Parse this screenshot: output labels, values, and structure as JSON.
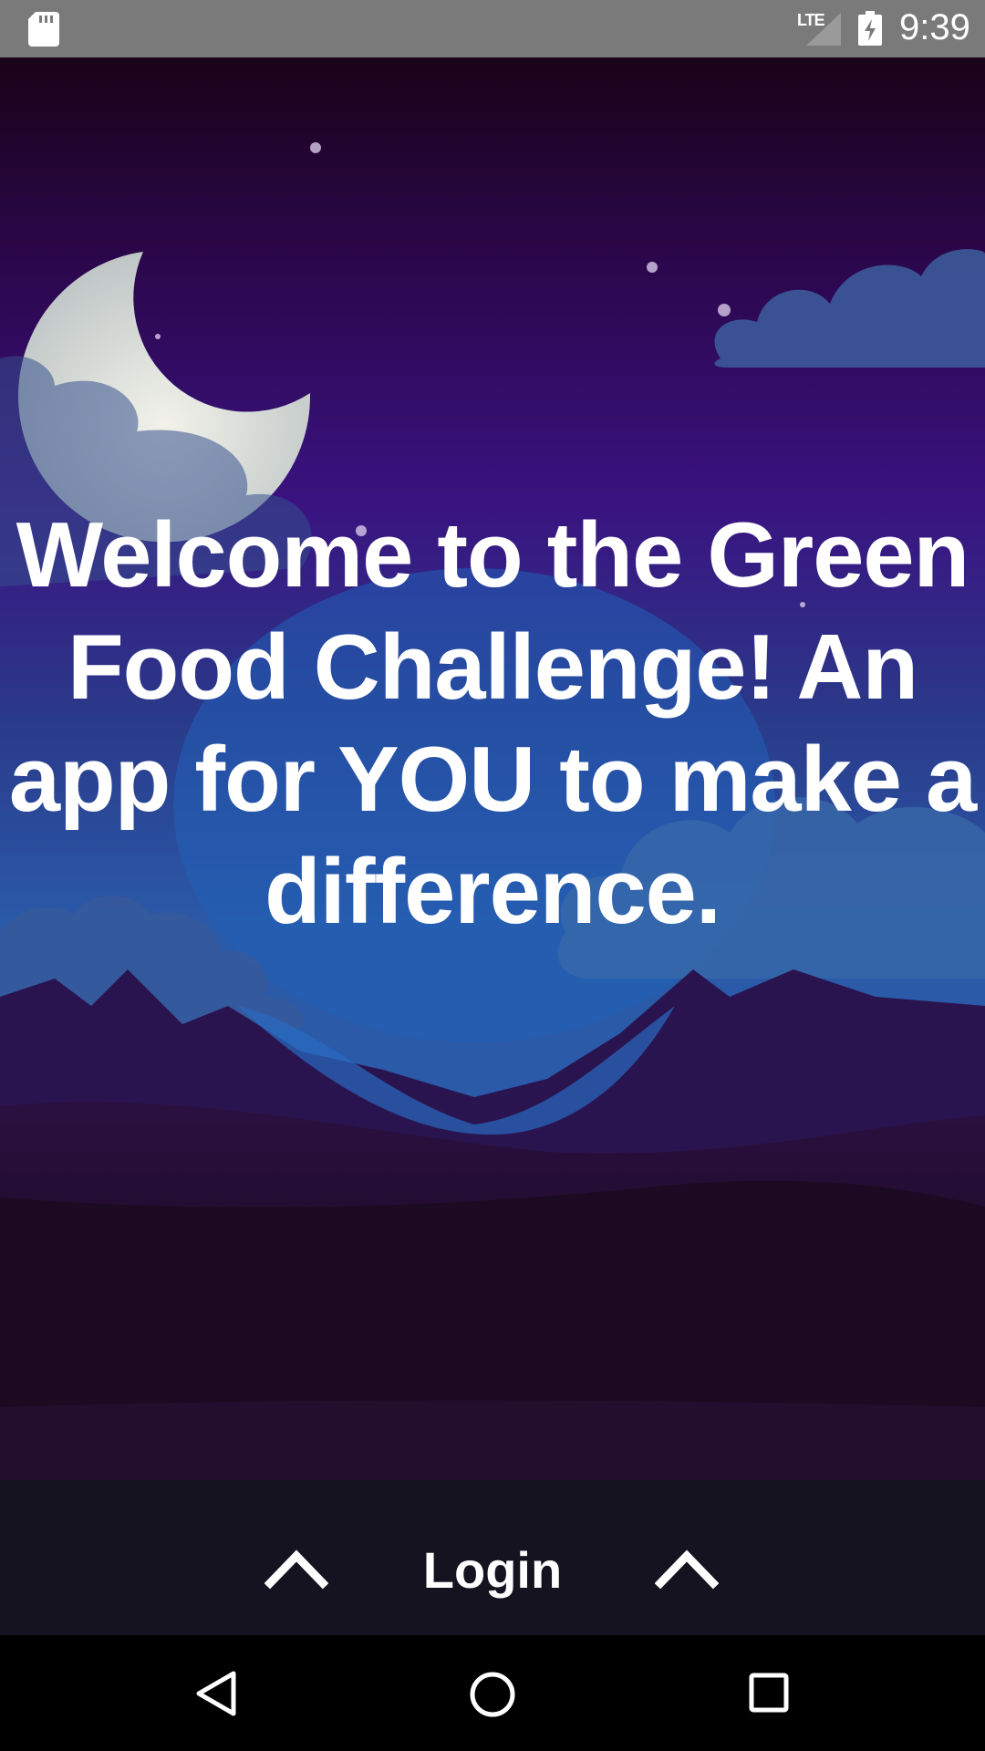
{
  "status_bar": {
    "network": "LTE",
    "time": "9:39",
    "icons": [
      "sd-card-icon",
      "signal-icon",
      "battery-charging-icon"
    ]
  },
  "welcome": {
    "headline": "Welcome to the Green Food Challenge! An app for YOU to make a difference."
  },
  "login": {
    "label": "Login",
    "icons": [
      "chevron-up-icon",
      "chevron-up-icon"
    ]
  },
  "nav_bar": {
    "icons": [
      "back-icon",
      "home-icon",
      "recents-icon"
    ]
  },
  "colors": {
    "status_bar": "#7a7a7a",
    "sky_top": "#1a0418",
    "sky_mid": "#2a0a5a",
    "sky_low": "#2a4a9a",
    "text": "#ffffff",
    "nav_bar": "#000000"
  }
}
